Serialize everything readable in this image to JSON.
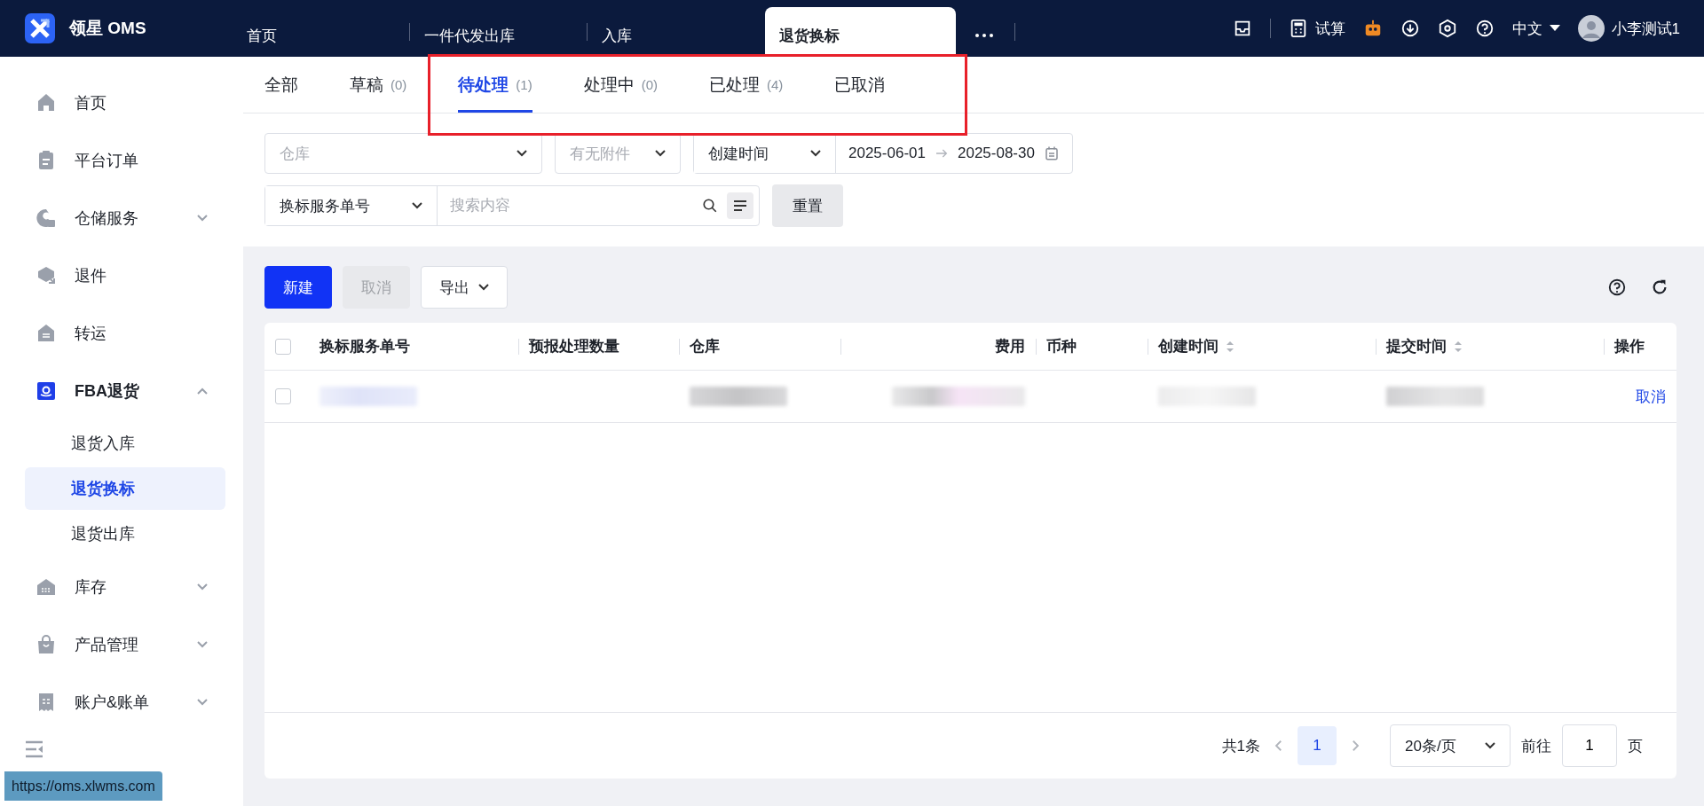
{
  "app": {
    "logo_text": "领星 OMS"
  },
  "top_tabs": [
    {
      "label": "首页",
      "selected": false
    },
    {
      "label": "一件代发出库",
      "selected": false
    },
    {
      "label": "入库",
      "selected": false
    },
    {
      "label": "退货换标",
      "selected": true
    }
  ],
  "header": {
    "calculator_label": "试算",
    "language": "中文",
    "user_name": "小李测试1"
  },
  "sidebar": {
    "items": [
      {
        "label": "首页",
        "selected": false
      },
      {
        "label": "平台订单",
        "selected": false
      },
      {
        "label": "仓储服务",
        "selected": false,
        "expanded": false
      },
      {
        "label": "退件",
        "selected": false
      },
      {
        "label": "转运",
        "selected": false
      },
      {
        "label": "FBA退货",
        "selected": false,
        "expanded": true,
        "children": [
          {
            "label": "退货入库",
            "selected": false
          },
          {
            "label": "退货换标",
            "selected": true
          },
          {
            "label": "退货出库",
            "selected": false
          }
        ]
      },
      {
        "label": "库存",
        "selected": false,
        "expanded": false
      },
      {
        "label": "产品管理",
        "selected": false,
        "expanded": false
      },
      {
        "label": "账户&账单",
        "selected": false,
        "expanded": false
      }
    ]
  },
  "status_tabs": [
    {
      "label": "全部",
      "selected": false
    },
    {
      "label": "草稿",
      "count": "(0)",
      "selected": false
    },
    {
      "label": "待处理",
      "count": "(1)",
      "selected": true
    },
    {
      "label": "处理中",
      "count": "(0)",
      "selected": false
    },
    {
      "label": "已处理",
      "count": "(4)",
      "selected": false
    },
    {
      "label": "已取消",
      "selected": false
    }
  ],
  "filters": {
    "warehouse": {
      "placeholder": "仓库"
    },
    "attachment": {
      "placeholder": "有无附件"
    },
    "date_type": "创建时间",
    "date_start": "2025-06-01",
    "date_end": "2025-08-30",
    "search_type": "换标服务单号",
    "search": {
      "placeholder": "搜索内容"
    },
    "reset": "重置"
  },
  "toolbar": {
    "new": "新建",
    "cancel": {
      "label": "取消",
      "disabled": true
    },
    "export": "导出"
  },
  "table": {
    "columns": [
      {
        "label": "换标服务单号",
        "sortable": false
      },
      {
        "label": "预报处理数量",
        "sortable": false
      },
      {
        "label": "仓库",
        "sortable": false
      },
      {
        "label": "费用",
        "sortable": false
      },
      {
        "label": "币种",
        "sortable": false
      },
      {
        "label": "创建时间",
        "sortable": true
      },
      {
        "label": "提交时间",
        "sortable": true
      },
      {
        "label": "操作",
        "sortable": false
      }
    ],
    "select_all_checked": false,
    "rows": [
      {
        "checked": false,
        "action": "取消"
      }
    ]
  },
  "pagination": {
    "total": "共1条",
    "pages": [
      {
        "label": "1",
        "selected": true
      }
    ],
    "page_size": "20条/页",
    "goto_label": "前往",
    "goto_value": "1",
    "page_suffix": "页"
  },
  "status_url": "https://oms.xlwms.com"
}
